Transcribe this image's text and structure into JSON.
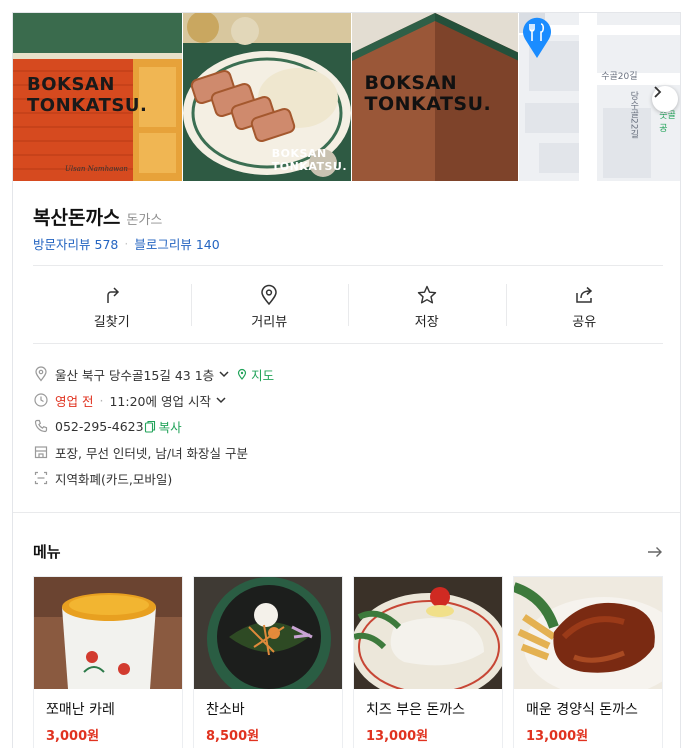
{
  "photos": {
    "brand_line1": "BOKSAN",
    "brand_line2": "TONKATSU.",
    "signature": "Ulsan Namhawan",
    "map": {
      "street_label": "수골20길",
      "street_label2": "당수골22길",
      "green_label": "숫골공",
      "next_icon": "chevron-right-icon",
      "pin_icon": "restaurant-pin-icon",
      "pin_color": "#1a8cff"
    }
  },
  "place": {
    "name": "복산돈까스",
    "category": "돈가스",
    "visitor_reviews_label": "방문자리뷰",
    "visitor_reviews_count": "578",
    "blog_reviews_label": "블로그리뷰",
    "blog_reviews_count": "140"
  },
  "actions": [
    {
      "label": "길찾기",
      "icon": "directions-icon"
    },
    {
      "label": "거리뷰",
      "icon": "location-pin-icon"
    },
    {
      "label": "저장",
      "icon": "star-icon"
    },
    {
      "label": "공유",
      "icon": "share-icon"
    }
  ],
  "info": {
    "address": "울산 북구 당수골15길 43 1층",
    "map_link": "지도",
    "status": "영업 전",
    "open_time": "11:20에 영업 시작",
    "phone": "052-295-4623",
    "copy_label": "복사",
    "amenities": "포장, 무선 인터넷, 남/녀 화장실 구분",
    "payment": "지역화폐(카드,모바일)"
  },
  "menu": {
    "title": "메뉴",
    "more_icon": "arrow-right-icon",
    "items": [
      {
        "name": "쪼매난 카레",
        "price": "3,000원"
      },
      {
        "name": "찬소바",
        "price": "8,500원"
      },
      {
        "name": "치즈 부은 돈까스",
        "price": "13,000원"
      },
      {
        "name": "매운 경양식 돈까스",
        "price": "13,000원"
      }
    ]
  },
  "colors": {
    "accent_blue": "#2565c1",
    "accent_green": "#22a35a",
    "accent_red": "#e0321f"
  }
}
